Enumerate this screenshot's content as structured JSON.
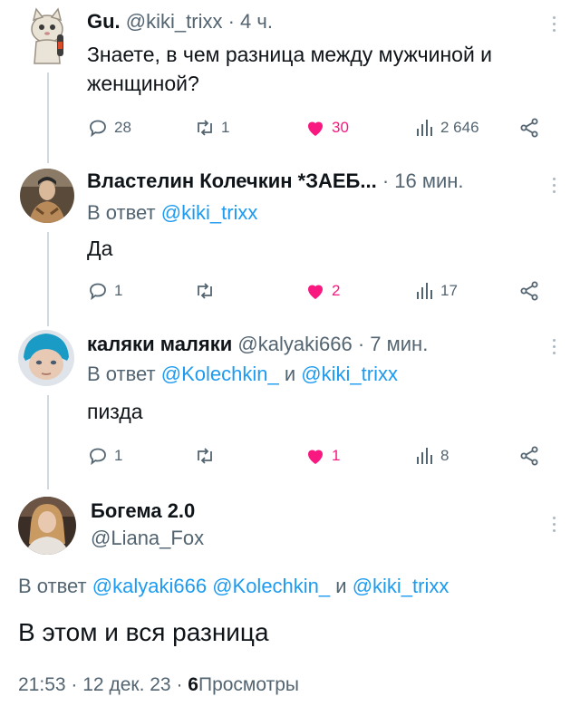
{
  "tweets": [
    {
      "name": "Gu.",
      "handle": "@kiki_trixx",
      "sep": "·",
      "time": "4 ч.",
      "text": "Знаете, в чем разница между мужчиной и женщиной?",
      "replies": "28",
      "retweets": "1",
      "likes": "30",
      "views": "2 646"
    },
    {
      "name": "Властелин Колечкин *ЗАЕБ...",
      "sep": "·",
      "time": "16 мин.",
      "reply_prefix": "В ответ",
      "reply_to": "@kiki_trixx",
      "text": "Да",
      "replies": "1",
      "retweets": "",
      "likes": "2",
      "views": "17"
    },
    {
      "name": "каляки маляки",
      "handle": "@kalyaki666",
      "sep": "·",
      "time": "7 мин.",
      "reply_prefix": "В ответ",
      "reply_to_1": "@Kolechkin_",
      "reply_and": "и",
      "reply_to_2": "@kiki_trixx",
      "text": "пизда",
      "replies": "1",
      "retweets": "",
      "likes": "1",
      "views": "8"
    }
  ],
  "main": {
    "name": "Богема 2.0",
    "handle": "@Liana_Fox",
    "reply_prefix": "В ответ",
    "reply_to_1": "@kalyaki666",
    "reply_to_2": "@Kolechkin_",
    "reply_and": "и",
    "reply_to_3": "@kiki_trixx",
    "text": "В этом и вся разница",
    "time": "21:53",
    "date": "12 дек. 23",
    "sep": "·",
    "views_count": "6",
    "views_label": "Просмотры"
  },
  "colors": {
    "accent": "#1d9bf0",
    "like": "#f91880",
    "secondary": "#536471",
    "thread_line": "#cfd9de"
  },
  "icons": [
    "reply-icon",
    "retweet-icon",
    "heart-icon",
    "views-icon",
    "share-icon",
    "more-icon"
  ]
}
